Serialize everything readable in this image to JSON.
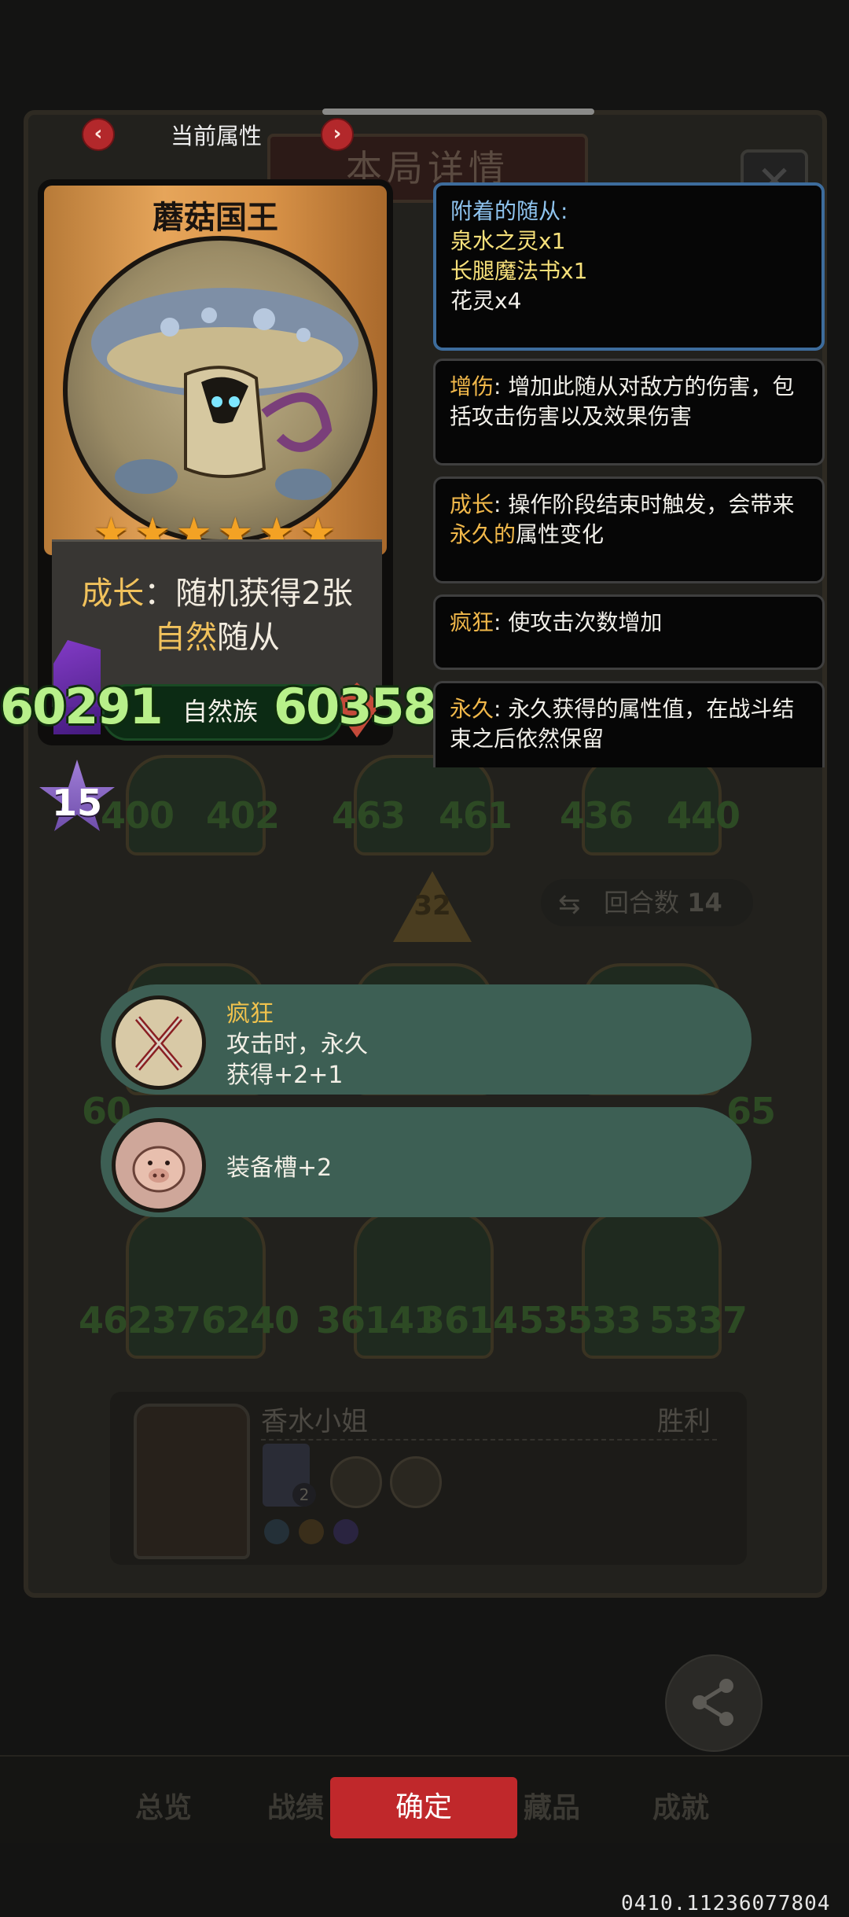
{
  "header": {
    "tab_title": "当前属性",
    "bg_title": "本局详情",
    "prev_label": "‹",
    "next_label": "›",
    "close_label": "✕"
  },
  "card": {
    "name": "蘑菇国王",
    "stars": "★★★★★★",
    "star_count": 6,
    "ability_keyword": "成长",
    "ability_text": "：随机获得2张",
    "ability_tribe": "自然",
    "ability_tail": "随从",
    "attack": "60291",
    "tribe": "自然族",
    "health": "60358",
    "level": "15"
  },
  "keywords": {
    "attached_title": "附着的随从:",
    "attached": [
      {
        "name": "泉水之灵",
        "count": "x1"
      },
      {
        "name": "长腿魔法书",
        "count": "x1"
      },
      {
        "name": "花灵",
        "count": "x4"
      }
    ],
    "items": [
      {
        "term": "增伤",
        "desc": ": 增加此随从对敌方的伤害，包括攻击伤害以及效果伤害"
      },
      {
        "term": "成长",
        "desc_pre": ": 操作阶段结束时触发，会带来",
        "highlight": "永久的",
        "desc_post": "属性变化"
      },
      {
        "term": "疯狂",
        "desc": ": 使攻击次数增加"
      },
      {
        "term": "永久",
        "desc": ": 永久获得的属性值，在战斗结束之后依然保留"
      }
    ]
  },
  "tooltips": [
    {
      "title": "疯狂",
      "line1": "攻击时，永久",
      "line2": "获得+2+1",
      "icon": "crossed-swords-icon"
    },
    {
      "line1": "装备槽+2",
      "icon": "pig-icon"
    }
  ],
  "background": {
    "level_marker": "32",
    "round_label": "回合数",
    "round_value": "14",
    "row1_stats": [
      "400",
      "402",
      "463",
      "461",
      "436",
      "440"
    ],
    "row2_stats": [
      "60",
      "65"
    ],
    "row3_stats": [
      "46237",
      "6240",
      "36141",
      "3614",
      "53533",
      "5337"
    ],
    "opponent_name": "香水小姐",
    "result": "胜利",
    "opponent_badge": "2"
  },
  "nav": {
    "items": [
      "总览",
      "战绩",
      "藏品",
      "成就"
    ],
    "confirm": "确定",
    "share": "分享"
  },
  "footer": {
    "version": "0410.11236077804"
  },
  "colors": {
    "accent_red": "#c0282b",
    "gold_text": "#f1c25c",
    "stat_green": "#b8f08a",
    "tooltip_green": "#3d5f54",
    "panel_border_blue": "#3d6c9c"
  }
}
